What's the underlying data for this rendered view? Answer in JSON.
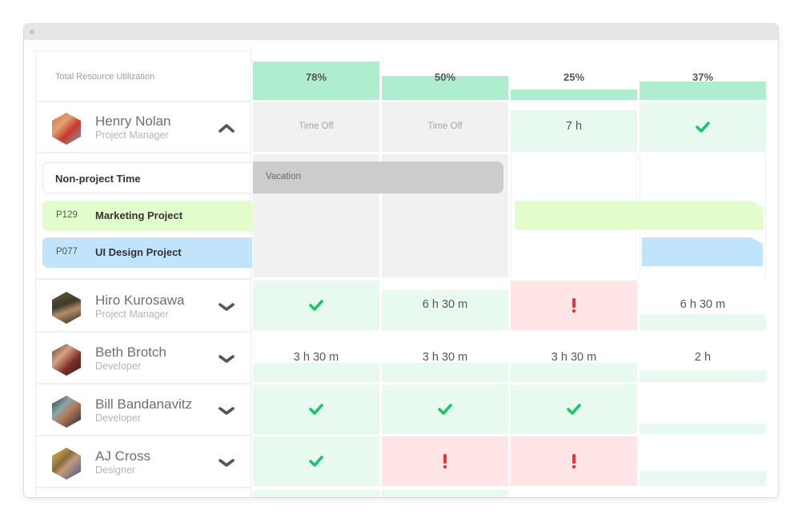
{
  "header": {
    "title": "Total Resource Utilization",
    "utilization": [
      "78%",
      "50%",
      "25%",
      "37%"
    ],
    "utilization_values": [
      0.78,
      0.5,
      0.25,
      0.37
    ]
  },
  "colors": {
    "utilization_bar": "#aeeecf",
    "ok_cell": "#e8faf0",
    "over_cell": "#ffe5e6",
    "time_off_cell": "#f1f1f1",
    "check": "#1ec46b",
    "alert": "#e8343b",
    "vacation_bar": "#cccccc",
    "marketing": "#e2fccb",
    "ui_design": "#c2e4fb"
  },
  "people": [
    {
      "name": "Henry Nolan",
      "role": "Project Manager",
      "expanded": true,
      "chevron": "chevron-up-icon",
      "cells": [
        {
          "type": "timeoff",
          "text": "Time Off"
        },
        {
          "type": "timeoff",
          "text": "Time Off"
        },
        {
          "type": "hours",
          "text": "7 h"
        },
        {
          "type": "check",
          "icon": "check-icon"
        }
      ]
    },
    {
      "name": "Hiro Kurosawa",
      "role": "Project Manager",
      "chevron": "chevron-down-icon",
      "cells": [
        {
          "type": "check",
          "icon": "check-icon"
        },
        {
          "type": "hours",
          "text": "6 h 30 m"
        },
        {
          "type": "alert",
          "icon": "exclamation-icon"
        },
        {
          "type": "hours",
          "text": "6 h 30 m"
        }
      ]
    },
    {
      "name": "Beth Brotch",
      "role": "Developer",
      "chevron": "chevron-down-icon",
      "cells": [
        {
          "type": "hours",
          "text": "3 h 30 m"
        },
        {
          "type": "hours",
          "text": "3 h 30 m"
        },
        {
          "type": "hours",
          "text": "3 h 30 m"
        },
        {
          "type": "hours",
          "text": "2 h"
        }
      ]
    },
    {
      "name": "Bill Bandanavitz",
      "role": "Developer",
      "chevron": "chevron-down-icon",
      "cells": [
        {
          "type": "check",
          "icon": "check-icon"
        },
        {
          "type": "check",
          "icon": "check-icon"
        },
        {
          "type": "check",
          "icon": "check-icon"
        },
        {
          "type": "empty"
        }
      ]
    },
    {
      "name": "AJ Cross",
      "role": "Designer",
      "chevron": "chevron-down-icon",
      "cells": [
        {
          "type": "check",
          "icon": "check-icon"
        },
        {
          "type": "alert",
          "icon": "exclamation-icon"
        },
        {
          "type": "alert",
          "icon": "exclamation-icon"
        },
        {
          "type": "empty"
        }
      ]
    }
  ],
  "expanded_tasks": [
    {
      "code": "",
      "name": "Non-project Time",
      "bar_label": "Vacation"
    },
    {
      "code": "P129",
      "name": "Marketing Project"
    },
    {
      "code": "P077",
      "name": "UI Design Project"
    }
  ]
}
